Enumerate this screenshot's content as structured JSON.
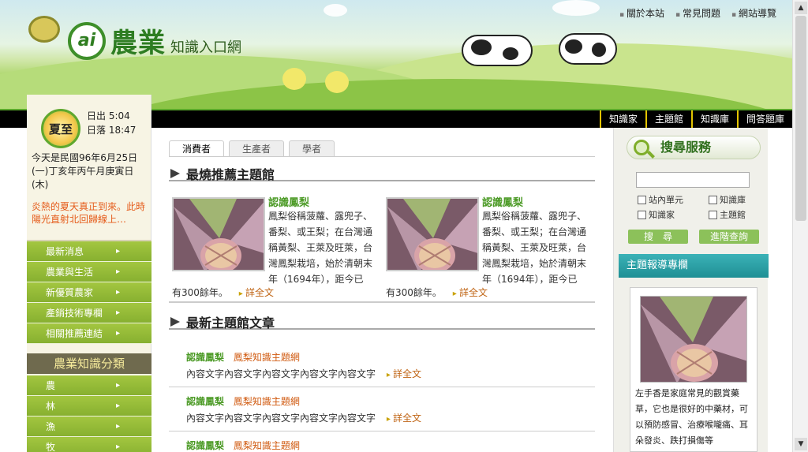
{
  "header": {
    "logo_mark": "ai",
    "logo_big": "農業",
    "logo_small": "知識入口網",
    "top_links": [
      "關於本站",
      "常見問題",
      "網站導覽"
    ],
    "nav_links": [
      "知識家",
      "主題館",
      "知識庫",
      "問答題庫"
    ]
  },
  "left": {
    "season": "夏至",
    "sunrise": "日出 5:04",
    "sunset": "日落 18:47",
    "date_line": "今天是民國96年6月25日(一)丁亥年丙午月庚寅日(木)",
    "weather_note": "炎熱的夏天真正到來。此時陽光直射北回歸線上…",
    "menu": [
      "最新消息",
      "農業與生活",
      "新優質農家",
      "產銷技術專欄",
      "相關推薦連結"
    ],
    "category_title": "農業知識分類",
    "categories": [
      "農",
      "林",
      "漁",
      "牧"
    ]
  },
  "main": {
    "tabs": [
      "消費者",
      "生產者",
      "學者"
    ],
    "section1_title": "最燒推薦主題館",
    "cards": [
      {
        "title": "認識鳳梨",
        "desc": "鳳梨俗稱菠蘿、露兜子、番梨、或王梨；在台灣通稱黃梨、王萊及旺萊，台灣鳳梨栽培，始於清朝末年（1694年），距今已",
        "tail": "有300餘年。",
        "more": "詳全文"
      },
      {
        "title": "認識鳳梨",
        "desc": "鳳梨俗稱菠蘿、露兜子、番梨、或王梨；在台灣通稱黃梨、王萊及旺萊，台灣鳳梨栽培，始於清朝末年（1694年），距今已",
        "tail": "有300餘年。",
        "more": "詳全文"
      }
    ],
    "section2_title": "最新主題館文章",
    "articles": [
      {
        "title": "認識鳳梨",
        "tag": "鳳梨知識主題網",
        "body": "內容文字內容文字內容文字內容文字內容文字",
        "more": "詳全文"
      },
      {
        "title": "認識鳳梨",
        "tag": "鳳梨知識主題網",
        "body": "內容文字內容文字內容文字內容文字內容文字",
        "more": "詳全文"
      },
      {
        "title": "認識鳳梨",
        "tag": "鳳梨知識主題網",
        "body": "",
        "more": ""
      }
    ]
  },
  "right": {
    "search_title": "搜尋服務",
    "search_value": "",
    "checkboxes": [
      "站內單元",
      "知識庫",
      "知識家",
      "主題館"
    ],
    "search_button": "搜　尋",
    "advanced_button": "進階查詢",
    "report_title": "主題報導專欄",
    "report_text": "左手香是家庭常見的觀賞藥草，它也是很好的中藥材，可以預防感冒、治療喉嚨痛、耳朵發炎、跌打損傷等"
  }
}
